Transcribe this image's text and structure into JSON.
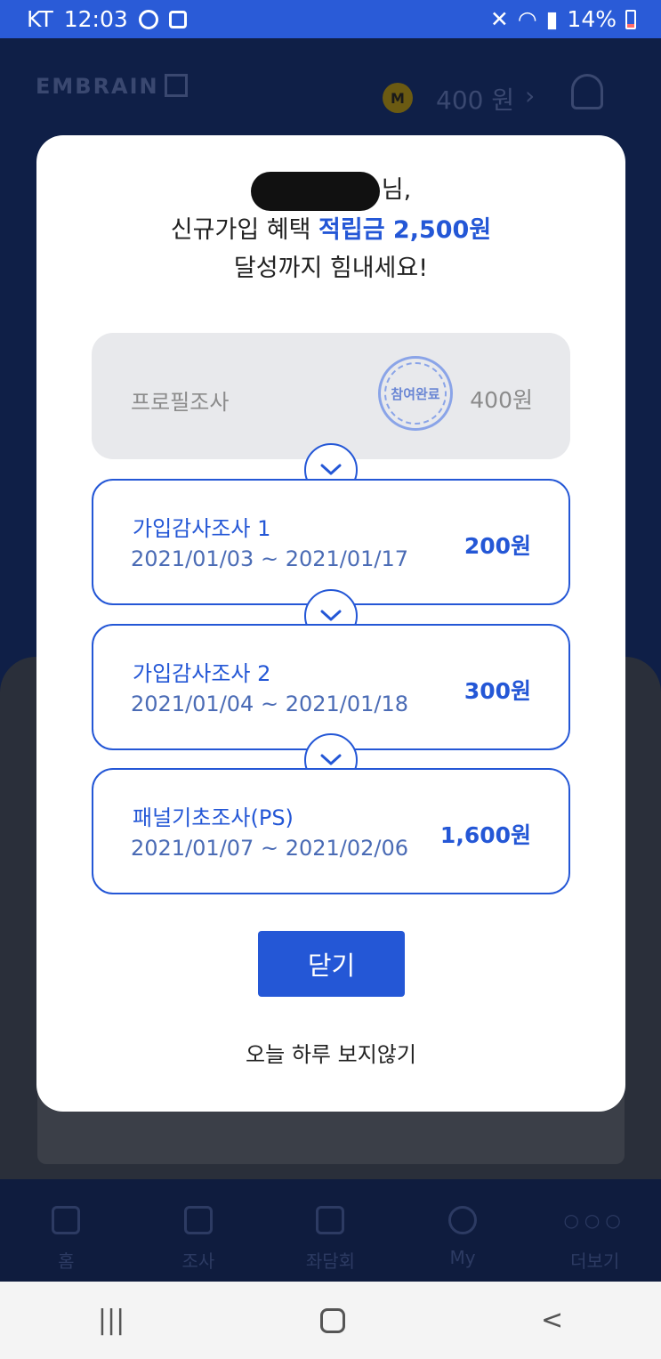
{
  "status_bar": {
    "carrier": "KT",
    "time": "12:03",
    "battery": "14%"
  },
  "app_header": {
    "logo": "EMBRAIN",
    "coin_label": "M",
    "points": "400 원",
    "chevron": "›"
  },
  "bottom_nav": {
    "items": [
      {
        "label": "홈",
        "icon": "home-icon"
      },
      {
        "label": "조사",
        "icon": "survey-icon"
      },
      {
        "label": "좌담회",
        "icon": "cup-icon"
      },
      {
        "label": "My",
        "icon": "user-icon"
      },
      {
        "label": "더보기",
        "icon": "more-icon"
      }
    ],
    "more_dots": "○○○"
  },
  "system_nav": {
    "recents": "|||",
    "back": "<"
  },
  "modal": {
    "greeting_suffix": "님,",
    "line2_prefix": "신규가입 혜택 ",
    "line2_highlight": "적립금 2,500원",
    "line3": "달성까지 힘내세요!",
    "steps": [
      {
        "title": "프로필조사",
        "reward": "400원",
        "status": "done",
        "stamp": "참여완료"
      },
      {
        "title": "가입감사조사 1",
        "dates": "2021/01/03 ~ 2021/01/17",
        "reward": "200원"
      },
      {
        "title": "가입감사조사 2",
        "dates": "2021/01/04 ~ 2021/01/18",
        "reward": "300원"
      },
      {
        "title": "패널기초조사(PS)",
        "dates": "2021/01/07 ~ 2021/02/06",
        "reward": "1,600원"
      }
    ],
    "close_label": "닫기",
    "hide_today_label": "오늘 하루 보지않기"
  },
  "colors": {
    "accent": "#2457d6",
    "status_bar": "#2a5bd7",
    "done_card": "#e8e9ec"
  }
}
